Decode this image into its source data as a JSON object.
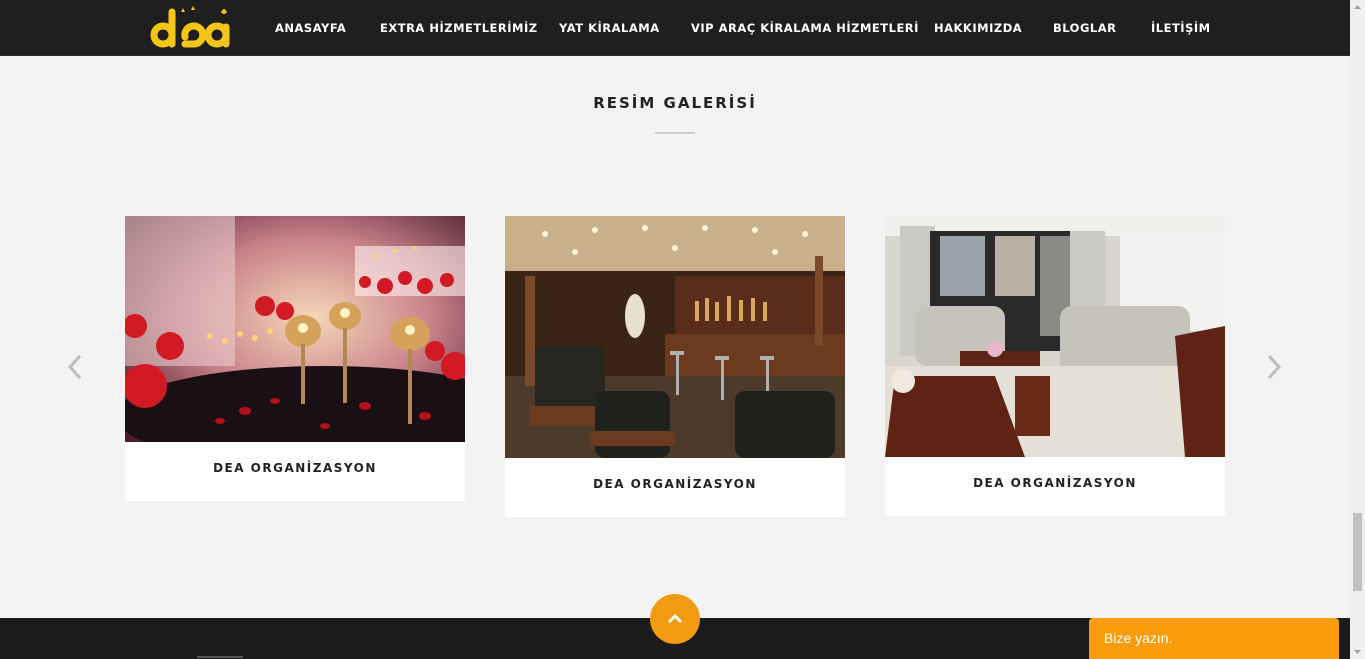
{
  "header": {
    "logo_text": "dea",
    "nav": [
      {
        "label": "ANASAYFA"
      },
      {
        "label": "EXTRA HİZMETLERİMİZ"
      },
      {
        "label": "YAT KİRALAMA"
      },
      {
        "label": "VIP ARAÇ KİRALAMA HİZMETLERİ"
      },
      {
        "label": "HAKKIMIZDA"
      },
      {
        "label": "BLOGLAR"
      },
      {
        "label": "İLETİŞİM"
      }
    ]
  },
  "gallery": {
    "title": "RESİM GALERİSİ",
    "cards": [
      {
        "caption": "DEA ORGANİZASYON",
        "image": "candles-romantic-table"
      },
      {
        "caption": "DEA ORGANİZASYON",
        "image": "yacht-bar-lounge"
      },
      {
        "caption": "DEA ORGANİZASYON",
        "image": "yacht-salon-interior"
      }
    ],
    "prev_icon": "chevron-left-icon",
    "next_icon": "chevron-right-icon"
  },
  "footer": {
    "to_top_icon": "chevron-up-icon",
    "chat_label": "Bize yazın."
  },
  "colors": {
    "nav_bg": "#1f1f1f",
    "page_bg": "#f3f3f3",
    "accent": "#f29a12",
    "logo": "#f5c518"
  }
}
